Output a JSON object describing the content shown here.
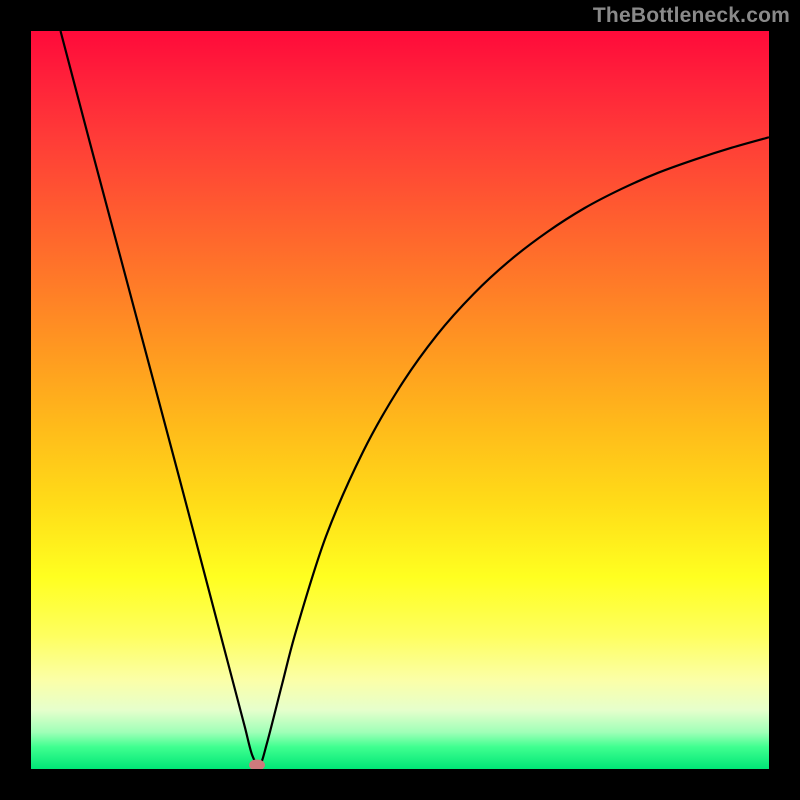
{
  "watermark": "TheBottleneck.com",
  "chart_data": {
    "type": "line",
    "title": "",
    "xlabel": "",
    "ylabel": "",
    "xlim": [
      0,
      100
    ],
    "ylim": [
      0,
      100
    ],
    "grid": false,
    "series": [
      {
        "name": "curve",
        "color": "#000000",
        "x": [
          4,
          8,
          12,
          16,
          20,
          24,
          26,
          28,
          29,
          30,
          31,
          32,
          34,
          36,
          40,
          45,
          50,
          55,
          60,
          65,
          70,
          75,
          80,
          85,
          90,
          95,
          100
        ],
        "y": [
          100,
          84.8,
          69.8,
          54.8,
          39.8,
          24.6,
          17,
          9.4,
          5.6,
          1.8,
          0.6,
          3.6,
          11.4,
          19,
          31.6,
          43,
          51.8,
          58.8,
          64.4,
          69,
          72.8,
          76,
          78.6,
          80.8,
          82.6,
          84.2,
          85.6
        ]
      }
    ],
    "marker": {
      "x": 30.6,
      "y": 0.5,
      "color": "#cf7a7c"
    },
    "gradient_stops": [
      {
        "pos": 0,
        "color": "#ff0a3a"
      },
      {
        "pos": 6,
        "color": "#ff1f3a"
      },
      {
        "pos": 14,
        "color": "#ff3a38"
      },
      {
        "pos": 24,
        "color": "#ff5a30"
      },
      {
        "pos": 34,
        "color": "#ff7a28"
      },
      {
        "pos": 44,
        "color": "#ff9b20"
      },
      {
        "pos": 54,
        "color": "#ffbc1a"
      },
      {
        "pos": 64,
        "color": "#ffdc18"
      },
      {
        "pos": 74,
        "color": "#ffff20"
      },
      {
        "pos": 82,
        "color": "#feff60"
      },
      {
        "pos": 88,
        "color": "#fbffa8"
      },
      {
        "pos": 92,
        "color": "#e6ffcc"
      },
      {
        "pos": 95,
        "color": "#a0ffb8"
      },
      {
        "pos": 97,
        "color": "#40ff90"
      },
      {
        "pos": 100,
        "color": "#00e676"
      }
    ]
  }
}
